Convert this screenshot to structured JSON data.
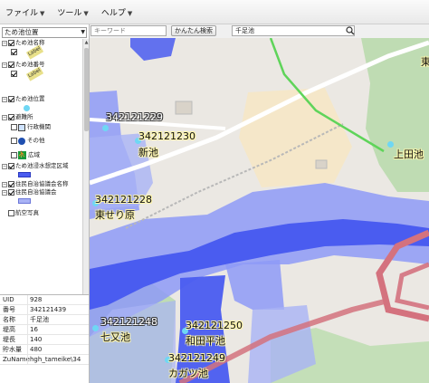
{
  "menu": {
    "file": "ファイル",
    "tools": "ツール",
    "help": "ヘルプ"
  },
  "left_panel": {
    "layer_select_value": "ため池位置",
    "layers": [
      {
        "label": "ため池名称",
        "checked": true
      },
      {
        "label": "Label",
        "checked": true
      },
      {
        "label": "ため池番号",
        "checked": true
      },
      {
        "label": "Label",
        "checked": true
      },
      {
        "label": "ため池位置",
        "checked": true
      },
      {
        "label": "避難所",
        "checked": true
      },
      {
        "label": "行政機関",
        "checked": false
      },
      {
        "label": "その他",
        "checked": false
      },
      {
        "label": "広域",
        "checked": false
      },
      {
        "label": "ため池浸水想定区域",
        "checked": true
      },
      {
        "label": "住民自治協議会名称",
        "checked": true
      },
      {
        "label": "住民自治協議会",
        "checked": true
      },
      {
        "label": "航空写真",
        "checked": false
      }
    ],
    "attributes": [
      {
        "key": "UID",
        "value": "928"
      },
      {
        "key": "番号",
        "value": "342121439"
      },
      {
        "key": "名称",
        "value": "千足池"
      },
      {
        "key": "堤高",
        "value": "16"
      },
      {
        "key": "堤長",
        "value": "140"
      },
      {
        "key": "貯水量",
        "value": "480"
      },
      {
        "key": "ZuName",
        "value": "hgh_tameike\\34"
      }
    ]
  },
  "search": {
    "keyword_placeholder": "キーワード",
    "simple_search_label": "かんたん検索",
    "name_value": "千足池"
  },
  "map": {
    "labels": [
      {
        "text": "342121229",
        "kind": "white"
      },
      {
        "text": "342121230",
        "kind": "yellow"
      },
      {
        "text": "新池",
        "kind": "yellow"
      },
      {
        "text": "上田池",
        "kind": "yellow"
      },
      {
        "text": "342121228",
        "kind": "yellow"
      },
      {
        "text": "東せり原",
        "kind": "yellow"
      },
      {
        "text": "342121248",
        "kind": "white"
      },
      {
        "text": "七又池",
        "kind": "yellow"
      },
      {
        "text": "342121250",
        "kind": "yellow"
      },
      {
        "text": "和田平池",
        "kind": "yellow"
      },
      {
        "text": "342121249",
        "kind": "yellow"
      },
      {
        "text": "カガツ池",
        "kind": "yellow"
      },
      {
        "text": "東",
        "kind": "yellow"
      }
    ],
    "colors": {
      "flood_area": "#4a5cf0",
      "flood_light": "#8e9af7",
      "district": "#a9b3f5",
      "green_area": "#bfdcb3",
      "pond_marker": "#6fd7f4",
      "road_pink": "#d4727e",
      "road_green": "#5fd45a"
    }
  }
}
